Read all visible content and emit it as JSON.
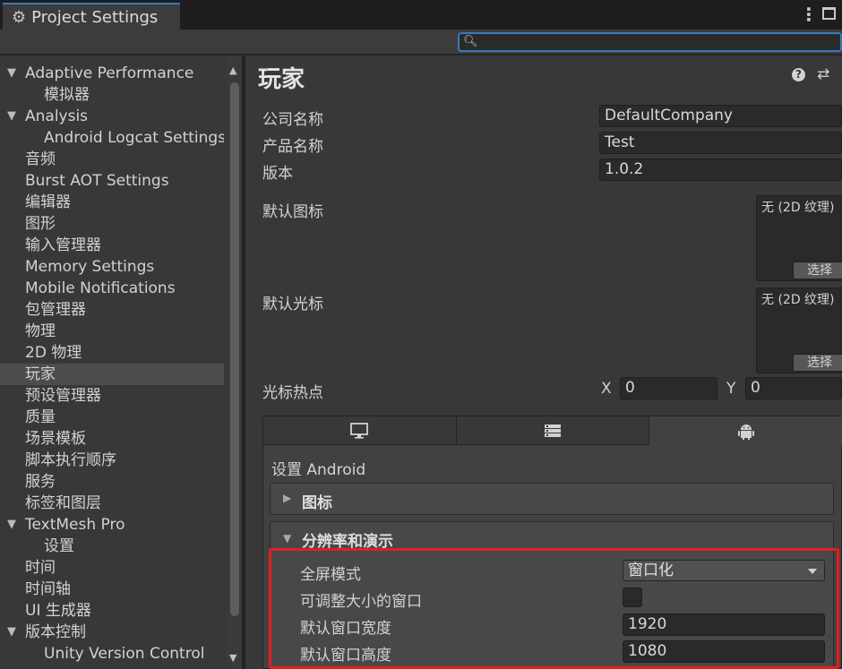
{
  "window": {
    "tab_title": "Project Settings"
  },
  "sidebar": {
    "items": [
      {
        "label": "Adaptive Performance",
        "indent": 1,
        "arrow": "▼"
      },
      {
        "label": "模拟器",
        "indent": 2
      },
      {
        "label": "Analysis",
        "indent": 1,
        "arrow": "▼"
      },
      {
        "label": "Android Logcat Settings",
        "indent": 2
      },
      {
        "label": "音频",
        "indent": 1
      },
      {
        "label": "Burst AOT Settings",
        "indent": 1
      },
      {
        "label": "编辑器",
        "indent": 1
      },
      {
        "label": "图形",
        "indent": 1
      },
      {
        "label": "输入管理器",
        "indent": 1
      },
      {
        "label": "Memory Settings",
        "indent": 1
      },
      {
        "label": "Mobile Notifications",
        "indent": 1
      },
      {
        "label": "包管理器",
        "indent": 1
      },
      {
        "label": "物理",
        "indent": 1
      },
      {
        "label": "2D 物理",
        "indent": 1
      },
      {
        "label": "玩家",
        "indent": 1,
        "selected": true
      },
      {
        "label": "预设管理器",
        "indent": 1
      },
      {
        "label": "质量",
        "indent": 1
      },
      {
        "label": "场景模板",
        "indent": 1
      },
      {
        "label": "脚本执行顺序",
        "indent": 1
      },
      {
        "label": "服务",
        "indent": 1
      },
      {
        "label": "标签和图层",
        "indent": 1
      },
      {
        "label": "TextMesh Pro",
        "indent": 1,
        "arrow": "▼"
      },
      {
        "label": "设置",
        "indent": 2
      },
      {
        "label": "时间",
        "indent": 1
      },
      {
        "label": "时间轴",
        "indent": 1
      },
      {
        "label": "UI 生成器",
        "indent": 1
      },
      {
        "label": "版本控制",
        "indent": 1,
        "arrow": "▼"
      },
      {
        "label": "Unity Version Control",
        "indent": 2
      }
    ]
  },
  "main": {
    "title": "玩家",
    "help_glyph": "?",
    "presets_glyph": "⇄",
    "company_label": "公司名称",
    "company_value": "DefaultCompany",
    "product_label": "产品名称",
    "product_value": "Test",
    "version_label": "版本",
    "version_value": "1.0.2",
    "default_icon_label": "默认图标",
    "default_cursor_label": "默认光标",
    "texture_none": "无 (2D 纹理)",
    "select_label": "选择",
    "hotspot_label": "光标热点",
    "hotspot_x_label": "X",
    "hotspot_x_value": "0",
    "hotspot_y_label": "Y",
    "hotspot_y_value": "0"
  },
  "platform": {
    "tabs": [
      {
        "icon": "monitor-icon"
      },
      {
        "icon": "server-icon"
      },
      {
        "icon": "android-icon",
        "active": true
      }
    ],
    "title": "设置 Android",
    "icon_section": "图标",
    "resolution_section": "分辨率和演示",
    "fullscreen_label": "全屏模式",
    "fullscreen_value": "窗口化",
    "resizable_label": "可调整大小的窗口",
    "resizable_checked": false,
    "width_label": "默认窗口宽度",
    "width_value": "1920",
    "height_label": "默认窗口高度",
    "height_value": "1080"
  },
  "colors": {
    "accent_blue": "#3a79bb",
    "highlight_red": "#e0201c",
    "panel_bg": "#383838",
    "field_bg": "#2a2a2a"
  }
}
